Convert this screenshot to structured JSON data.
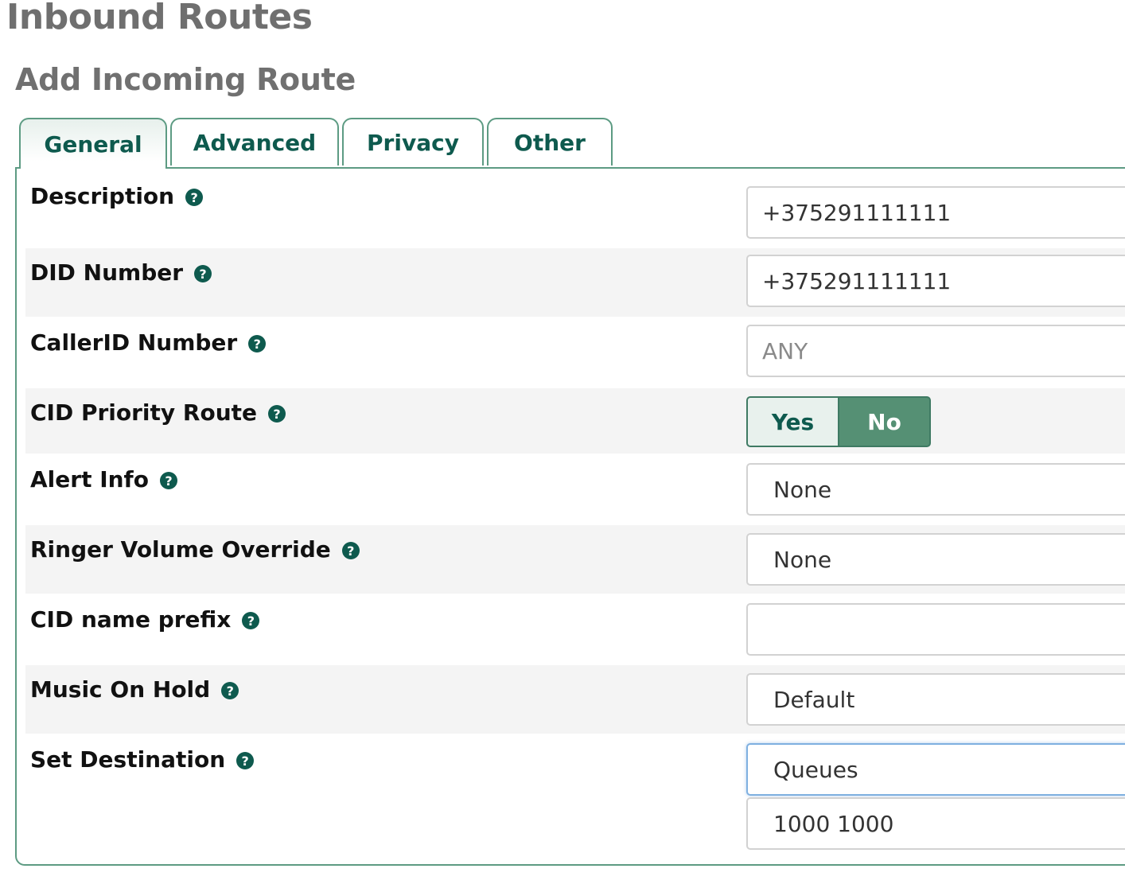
{
  "page": {
    "title": "Inbound Routes",
    "form_title": "Add Incoming Route"
  },
  "tabs": [
    {
      "label": "General",
      "active": true
    },
    {
      "label": "Advanced",
      "active": false
    },
    {
      "label": "Privacy",
      "active": false
    },
    {
      "label": "Other",
      "active": false
    }
  ],
  "form": {
    "description": {
      "label": "Description",
      "value": "+375291111111"
    },
    "did_number": {
      "label": "DID Number",
      "value": "+375291111111"
    },
    "callerid_number": {
      "label": "CallerID Number",
      "value": "",
      "placeholder": "ANY"
    },
    "cid_priority_route": {
      "label": "CID Priority Route",
      "yes_label": "Yes",
      "no_label": "No",
      "selected": "No"
    },
    "alert_info": {
      "label": "Alert Info",
      "value": "None"
    },
    "ringer_volume_override": {
      "label": "Ringer Volume Override",
      "value": "None"
    },
    "cid_name_prefix": {
      "label": "CID name prefix",
      "value": ""
    },
    "music_on_hold": {
      "label": "Music On Hold",
      "value": "Default"
    },
    "set_destination": {
      "label": "Set Destination",
      "category": "Queues",
      "target": "1000 1000"
    }
  },
  "help_icon": {
    "glyph": "?",
    "icon": "question-circle-icon"
  },
  "colors": {
    "accent": "#0e5a4e",
    "tab_border": "#5d9b83",
    "toggle_on": "#559074",
    "toggle_off": "#e8f1ed",
    "row_shade": "#f4f4f4"
  }
}
